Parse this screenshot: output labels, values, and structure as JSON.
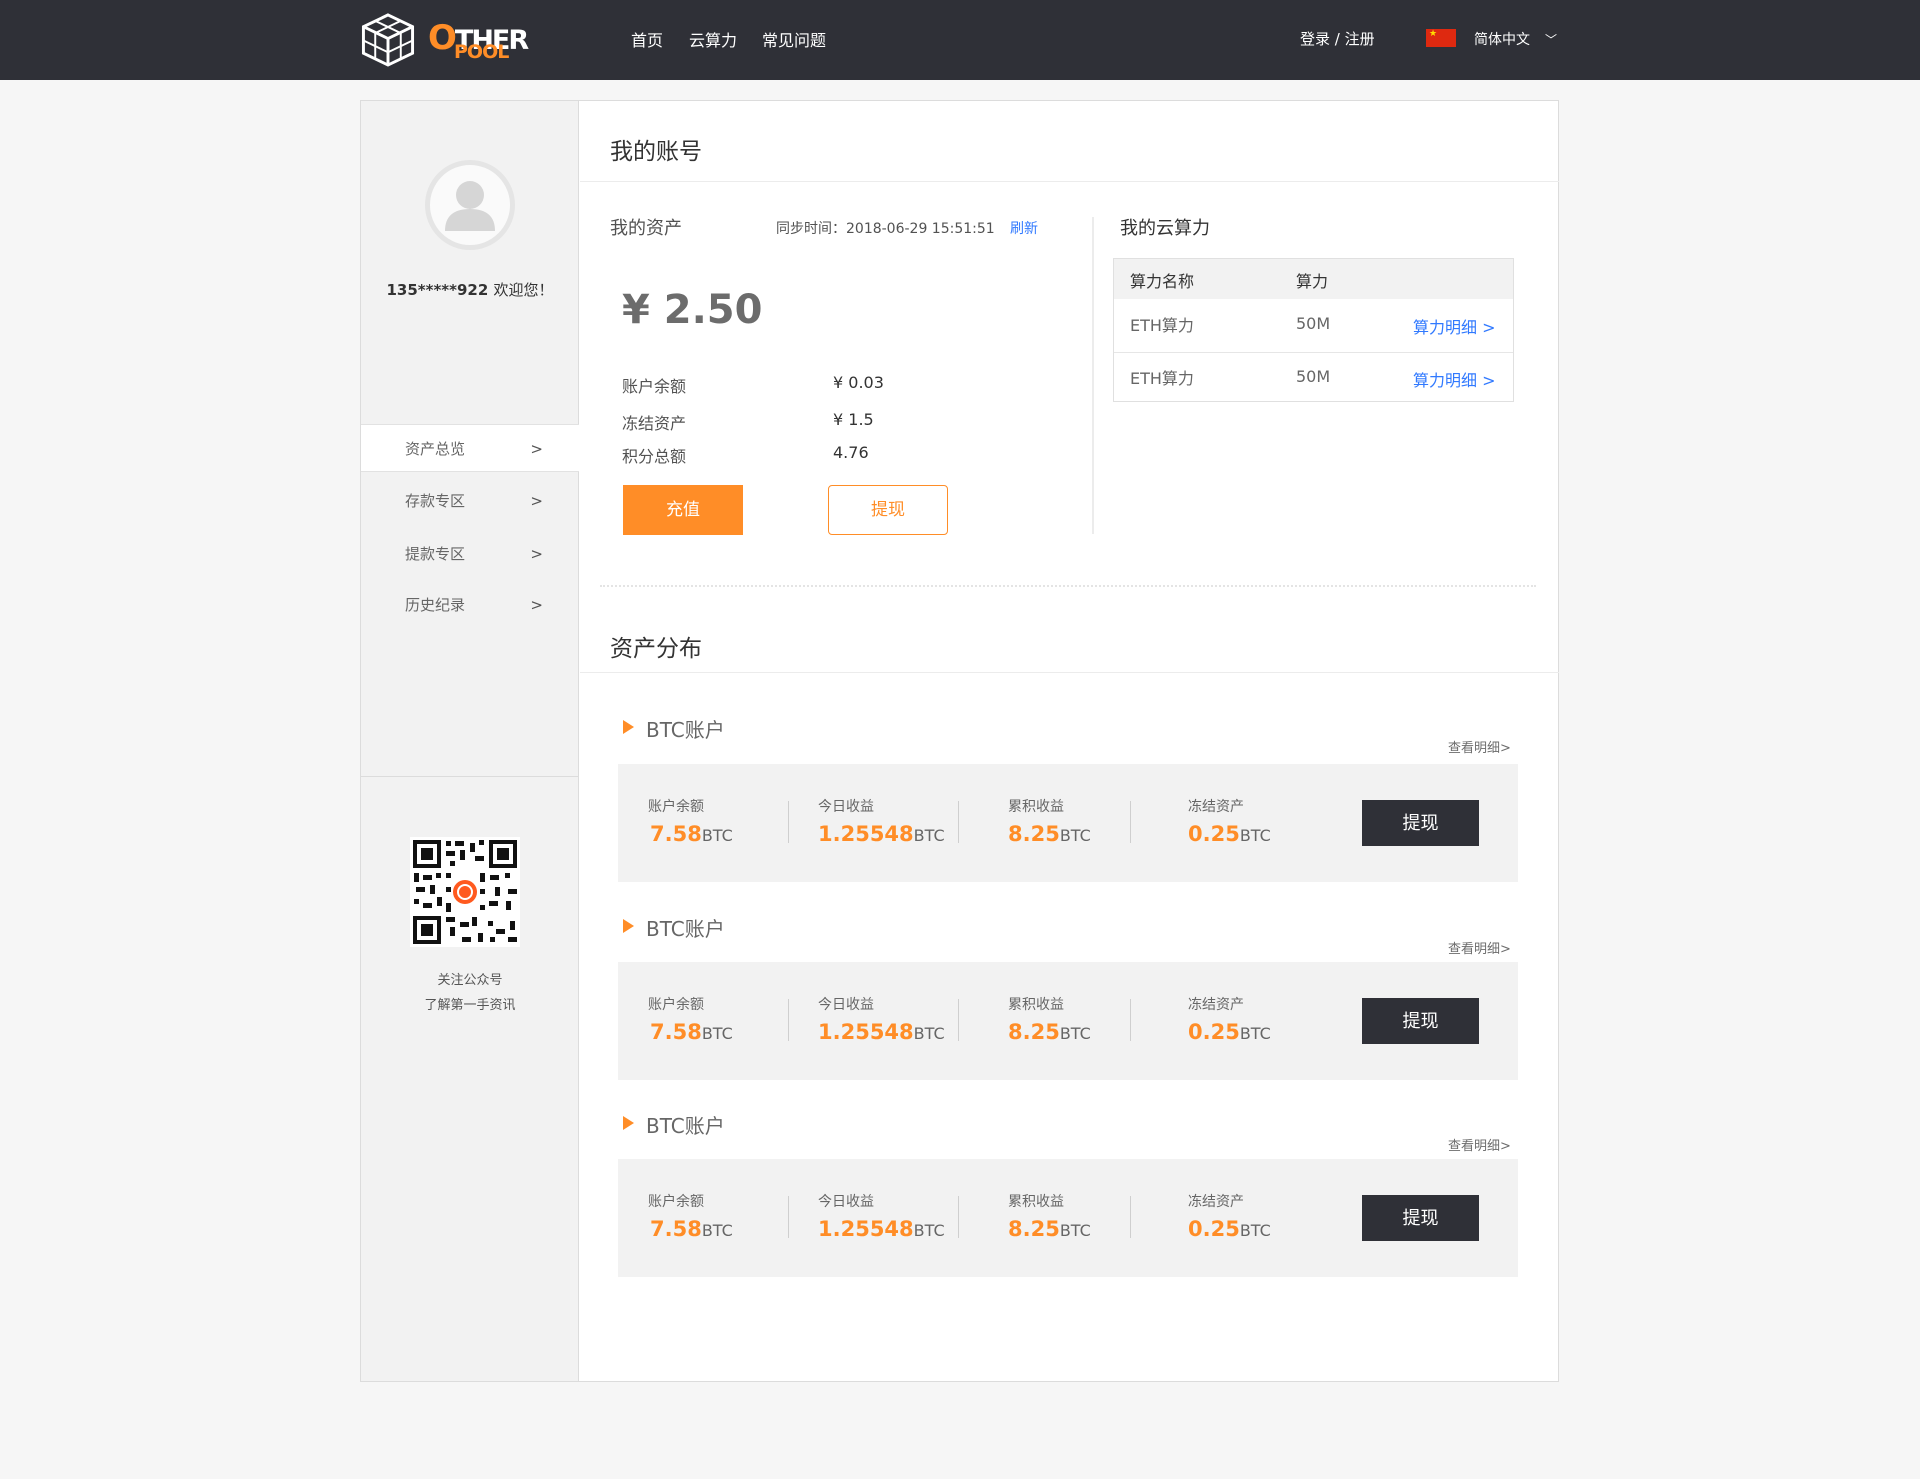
{
  "header": {
    "logo_top": "THER",
    "logo_o": "O",
    "logo_bottom": "POOL",
    "nav": [
      "首页",
      "云算力",
      "常见问题"
    ],
    "login": "登录 / 注册",
    "language": "简体中文"
  },
  "sidebar": {
    "user": "135*****922",
    "welcome": "欢迎您！",
    "menu": [
      {
        "label": "资产总览",
        "active": true
      },
      {
        "label": "存款专区",
        "active": false
      },
      {
        "label": "提款专区",
        "active": false
      },
      {
        "label": "历史纪录",
        "active": false
      }
    ],
    "qr_caption_1": "关注公众号",
    "qr_caption_2": "了解第一手资讯"
  },
  "account": {
    "title": "我的账号",
    "assets_label": "我的资产",
    "sync_label": "同步时间：",
    "sync_time": "2018-06-29 15:51:51",
    "refresh": "刷新",
    "total": "¥ 2.50",
    "rows": [
      {
        "label": "账户余额",
        "value": "¥ 0.03"
      },
      {
        "label": "冻结资产",
        "value": "¥ 1.5"
      },
      {
        "label": "积分总额",
        "value": "4.76"
      }
    ],
    "recharge_button": "充值",
    "withdraw_button": "提现"
  },
  "cloud": {
    "title": "我的云算力",
    "headers": [
      "算力名称",
      "算力"
    ],
    "rows": [
      {
        "name": "ETH算力",
        "value": "50M",
        "link": "算力明细 >"
      },
      {
        "name": "ETH算力",
        "value": "50M",
        "link": "算力明细 >"
      }
    ]
  },
  "distribution": {
    "title": "资产分布",
    "accounts": [
      {
        "name": "BTC账户",
        "detail": "查看明细>",
        "items": [
          {
            "label": "账户余额",
            "value": "7.58",
            "unit": "BTC"
          },
          {
            "label": "今日收益",
            "value": "1.25548",
            "unit": "BTC"
          },
          {
            "label": "累积收益",
            "value": "8.25",
            "unit": "BTC"
          },
          {
            "label": "冻结资产",
            "value": "0.25",
            "unit": "BTC"
          }
        ],
        "button": "提现"
      },
      {
        "name": "BTC账户",
        "detail": "查看明细>",
        "items": [
          {
            "label": "账户余额",
            "value": "7.58",
            "unit": "BTC"
          },
          {
            "label": "今日收益",
            "value": "1.25548",
            "unit": "BTC"
          },
          {
            "label": "累积收益",
            "value": "8.25",
            "unit": "BTC"
          },
          {
            "label": "冻结资产",
            "value": "0.25",
            "unit": "BTC"
          }
        ],
        "button": "提现"
      },
      {
        "name": "BTC账户",
        "detail": "查看明细>",
        "items": [
          {
            "label": "账户余额",
            "value": "7.58",
            "unit": "BTC"
          },
          {
            "label": "今日收益",
            "value": "1.25548",
            "unit": "BTC"
          },
          {
            "label": "累积收益",
            "value": "8.25",
            "unit": "BTC"
          },
          {
            "label": "冻结资产",
            "value": "0.25",
            "unit": "BTC"
          }
        ],
        "button": "提现"
      }
    ]
  },
  "colors": {
    "topbar": "#2f3037",
    "accent_orange": "#ff8d27",
    "link_blue": "#3079ff",
    "text_dark": "#333333",
    "text_mid": "#525252",
    "text_gray": "#666666",
    "amount_gray": "#6c6c6c"
  }
}
